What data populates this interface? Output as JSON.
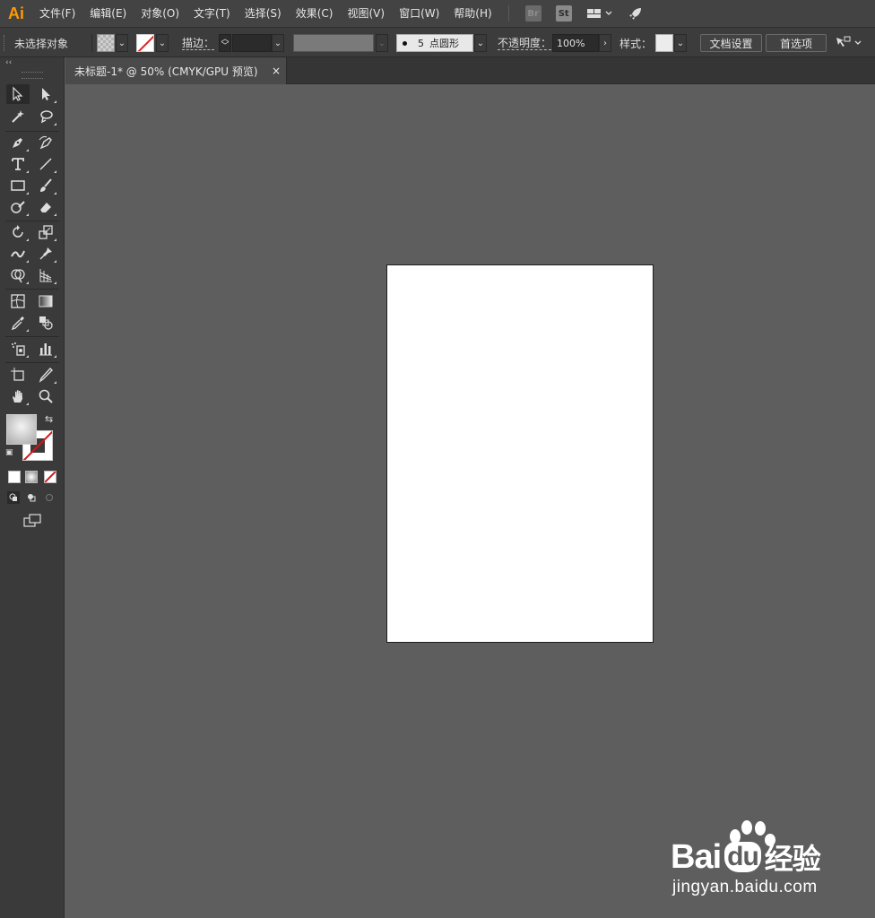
{
  "app": {
    "logo": "Ai",
    "brand_color": "#ff9a00"
  },
  "menu": [
    "文件(F)",
    "编辑(E)",
    "对象(O)",
    "文字(T)",
    "选择(S)",
    "效果(C)",
    "视图(V)",
    "窗口(W)",
    "帮助(H)"
  ],
  "menu_icons": {
    "bridge": "Br",
    "stock": "St"
  },
  "control": {
    "selection_status": "未选择对象",
    "stroke_label": "描边：",
    "brush_size": "5",
    "brush_name": "点圆形",
    "opacity_label": "不透明度：",
    "opacity_value": "100%",
    "style_label": "样式：",
    "doc_setup": "文档设置",
    "preferences": "首选项"
  },
  "document": {
    "tab_title": "未标题-1* @ 50% (CMYK/GPU 预览)",
    "close_symbol": "×"
  },
  "toolbar": {
    "collapse_symbol": "‹‹"
  },
  "watermark": {
    "brand_text_1": "Bai",
    "brand_text_2": "du",
    "brand_text_3": "经验",
    "url": "jingyan.baidu.com"
  }
}
